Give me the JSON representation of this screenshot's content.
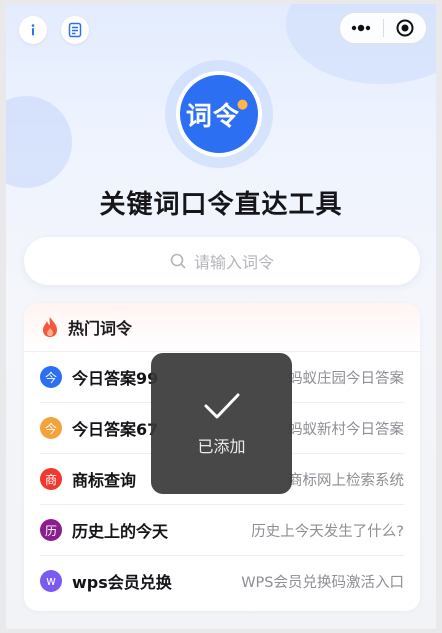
{
  "topbar": {
    "info_icon": "info-icon",
    "notes_icon": "notes-icon",
    "more_icon": "more-icon",
    "close_icon": "target-icon"
  },
  "logo": {
    "text": "词令",
    "accent": "#2c6ff2"
  },
  "page_title": "关键词口令直达工具",
  "search": {
    "placeholder": "请输入词令"
  },
  "hot_section": {
    "title": "热门词令",
    "icon": "fire-icon",
    "items": [
      {
        "badge": "今",
        "badge_color": "#2c6ff2",
        "name": "今日答案99",
        "desc": "蚂蚁庄园今日答案"
      },
      {
        "badge": "今",
        "badge_color": "#f5a23b",
        "name": "今日答案67",
        "desc": "蚂蚁新村今日答案"
      },
      {
        "badge": "商",
        "badge_color": "#f2382e",
        "name": "商标查询",
        "desc": "商标网上检索系统"
      },
      {
        "badge": "历",
        "badge_color": "#8b1e8f",
        "name": "历史上的今天",
        "desc": "历史上今天发生了什么?"
      },
      {
        "badge": "w",
        "badge_color": "#7a5af0",
        "name": "wps会员兑换",
        "desc": "WPS会员兑换码激活入口"
      }
    ]
  },
  "toast": {
    "text": "已添加",
    "icon": "check-icon"
  }
}
